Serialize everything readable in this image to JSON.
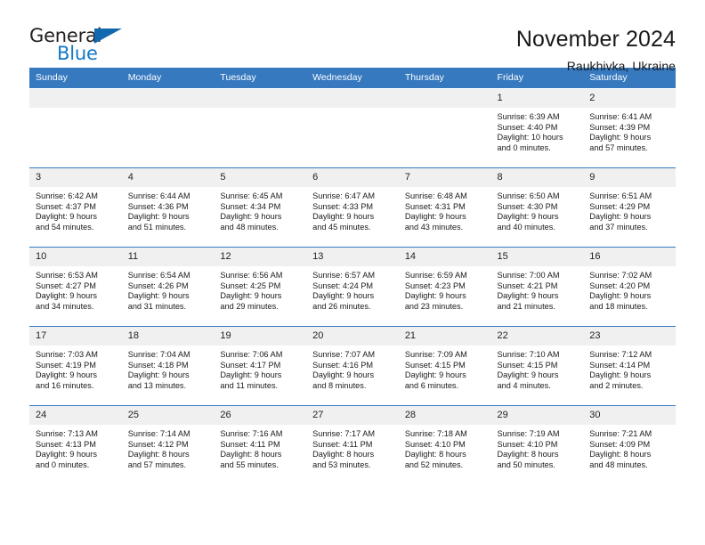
{
  "logo": {
    "word_top": "General",
    "word_bottom": "Blue",
    "triangle_color": "#1269b0",
    "blue_color": "#1478c4",
    "dark_color": "#231f20"
  },
  "header": {
    "title": "November 2024",
    "location": "Raukhivka, Ukraine"
  },
  "theme": {
    "header_bg": "#3679bf",
    "daynum_bg": "#f0f0f0",
    "text": "#1a1a1a"
  },
  "weekdays": [
    "Sunday",
    "Monday",
    "Tuesday",
    "Wednesday",
    "Thursday",
    "Friday",
    "Saturday"
  ],
  "weeks": [
    [
      {
        "day": "",
        "blank": true,
        "sunrise": "",
        "sunset": "",
        "daylight1": "",
        "daylight2": ""
      },
      {
        "day": "",
        "blank": true,
        "sunrise": "",
        "sunset": "",
        "daylight1": "",
        "daylight2": ""
      },
      {
        "day": "",
        "blank": true,
        "sunrise": "",
        "sunset": "",
        "daylight1": "",
        "daylight2": ""
      },
      {
        "day": "",
        "blank": true,
        "sunrise": "",
        "sunset": "",
        "daylight1": "",
        "daylight2": ""
      },
      {
        "day": "",
        "blank": true,
        "sunrise": "",
        "sunset": "",
        "daylight1": "",
        "daylight2": ""
      },
      {
        "day": "1",
        "blank": false,
        "sunrise": "Sunrise: 6:39 AM",
        "sunset": "Sunset: 4:40 PM",
        "daylight1": "Daylight: 10 hours",
        "daylight2": "and 0 minutes."
      },
      {
        "day": "2",
        "blank": false,
        "sunrise": "Sunrise: 6:41 AM",
        "sunset": "Sunset: 4:39 PM",
        "daylight1": "Daylight: 9 hours",
        "daylight2": "and 57 minutes."
      }
    ],
    [
      {
        "day": "3",
        "blank": false,
        "sunrise": "Sunrise: 6:42 AM",
        "sunset": "Sunset: 4:37 PM",
        "daylight1": "Daylight: 9 hours",
        "daylight2": "and 54 minutes."
      },
      {
        "day": "4",
        "blank": false,
        "sunrise": "Sunrise: 6:44 AM",
        "sunset": "Sunset: 4:36 PM",
        "daylight1": "Daylight: 9 hours",
        "daylight2": "and 51 minutes."
      },
      {
        "day": "5",
        "blank": false,
        "sunrise": "Sunrise: 6:45 AM",
        "sunset": "Sunset: 4:34 PM",
        "daylight1": "Daylight: 9 hours",
        "daylight2": "and 48 minutes."
      },
      {
        "day": "6",
        "blank": false,
        "sunrise": "Sunrise: 6:47 AM",
        "sunset": "Sunset: 4:33 PM",
        "daylight1": "Daylight: 9 hours",
        "daylight2": "and 45 minutes."
      },
      {
        "day": "7",
        "blank": false,
        "sunrise": "Sunrise: 6:48 AM",
        "sunset": "Sunset: 4:31 PM",
        "daylight1": "Daylight: 9 hours",
        "daylight2": "and 43 minutes."
      },
      {
        "day": "8",
        "blank": false,
        "sunrise": "Sunrise: 6:50 AM",
        "sunset": "Sunset: 4:30 PM",
        "daylight1": "Daylight: 9 hours",
        "daylight2": "and 40 minutes."
      },
      {
        "day": "9",
        "blank": false,
        "sunrise": "Sunrise: 6:51 AM",
        "sunset": "Sunset: 4:29 PM",
        "daylight1": "Daylight: 9 hours",
        "daylight2": "and 37 minutes."
      }
    ],
    [
      {
        "day": "10",
        "blank": false,
        "sunrise": "Sunrise: 6:53 AM",
        "sunset": "Sunset: 4:27 PM",
        "daylight1": "Daylight: 9 hours",
        "daylight2": "and 34 minutes."
      },
      {
        "day": "11",
        "blank": false,
        "sunrise": "Sunrise: 6:54 AM",
        "sunset": "Sunset: 4:26 PM",
        "daylight1": "Daylight: 9 hours",
        "daylight2": "and 31 minutes."
      },
      {
        "day": "12",
        "blank": false,
        "sunrise": "Sunrise: 6:56 AM",
        "sunset": "Sunset: 4:25 PM",
        "daylight1": "Daylight: 9 hours",
        "daylight2": "and 29 minutes."
      },
      {
        "day": "13",
        "blank": false,
        "sunrise": "Sunrise: 6:57 AM",
        "sunset": "Sunset: 4:24 PM",
        "daylight1": "Daylight: 9 hours",
        "daylight2": "and 26 minutes."
      },
      {
        "day": "14",
        "blank": false,
        "sunrise": "Sunrise: 6:59 AM",
        "sunset": "Sunset: 4:23 PM",
        "daylight1": "Daylight: 9 hours",
        "daylight2": "and 23 minutes."
      },
      {
        "day": "15",
        "blank": false,
        "sunrise": "Sunrise: 7:00 AM",
        "sunset": "Sunset: 4:21 PM",
        "daylight1": "Daylight: 9 hours",
        "daylight2": "and 21 minutes."
      },
      {
        "day": "16",
        "blank": false,
        "sunrise": "Sunrise: 7:02 AM",
        "sunset": "Sunset: 4:20 PM",
        "daylight1": "Daylight: 9 hours",
        "daylight2": "and 18 minutes."
      }
    ],
    [
      {
        "day": "17",
        "blank": false,
        "sunrise": "Sunrise: 7:03 AM",
        "sunset": "Sunset: 4:19 PM",
        "daylight1": "Daylight: 9 hours",
        "daylight2": "and 16 minutes."
      },
      {
        "day": "18",
        "blank": false,
        "sunrise": "Sunrise: 7:04 AM",
        "sunset": "Sunset: 4:18 PM",
        "daylight1": "Daylight: 9 hours",
        "daylight2": "and 13 minutes."
      },
      {
        "day": "19",
        "blank": false,
        "sunrise": "Sunrise: 7:06 AM",
        "sunset": "Sunset: 4:17 PM",
        "daylight1": "Daylight: 9 hours",
        "daylight2": "and 11 minutes."
      },
      {
        "day": "20",
        "blank": false,
        "sunrise": "Sunrise: 7:07 AM",
        "sunset": "Sunset: 4:16 PM",
        "daylight1": "Daylight: 9 hours",
        "daylight2": "and 8 minutes."
      },
      {
        "day": "21",
        "blank": false,
        "sunrise": "Sunrise: 7:09 AM",
        "sunset": "Sunset: 4:15 PM",
        "daylight1": "Daylight: 9 hours",
        "daylight2": "and 6 minutes."
      },
      {
        "day": "22",
        "blank": false,
        "sunrise": "Sunrise: 7:10 AM",
        "sunset": "Sunset: 4:15 PM",
        "daylight1": "Daylight: 9 hours",
        "daylight2": "and 4 minutes."
      },
      {
        "day": "23",
        "blank": false,
        "sunrise": "Sunrise: 7:12 AM",
        "sunset": "Sunset: 4:14 PM",
        "daylight1": "Daylight: 9 hours",
        "daylight2": "and 2 minutes."
      }
    ],
    [
      {
        "day": "24",
        "blank": false,
        "sunrise": "Sunrise: 7:13 AM",
        "sunset": "Sunset: 4:13 PM",
        "daylight1": "Daylight: 9 hours",
        "daylight2": "and 0 minutes."
      },
      {
        "day": "25",
        "blank": false,
        "sunrise": "Sunrise: 7:14 AM",
        "sunset": "Sunset: 4:12 PM",
        "daylight1": "Daylight: 8 hours",
        "daylight2": "and 57 minutes."
      },
      {
        "day": "26",
        "blank": false,
        "sunrise": "Sunrise: 7:16 AM",
        "sunset": "Sunset: 4:11 PM",
        "daylight1": "Daylight: 8 hours",
        "daylight2": "and 55 minutes."
      },
      {
        "day": "27",
        "blank": false,
        "sunrise": "Sunrise: 7:17 AM",
        "sunset": "Sunset: 4:11 PM",
        "daylight1": "Daylight: 8 hours",
        "daylight2": "and 53 minutes."
      },
      {
        "day": "28",
        "blank": false,
        "sunrise": "Sunrise: 7:18 AM",
        "sunset": "Sunset: 4:10 PM",
        "daylight1": "Daylight: 8 hours",
        "daylight2": "and 52 minutes."
      },
      {
        "day": "29",
        "blank": false,
        "sunrise": "Sunrise: 7:19 AM",
        "sunset": "Sunset: 4:10 PM",
        "daylight1": "Daylight: 8 hours",
        "daylight2": "and 50 minutes."
      },
      {
        "day": "30",
        "blank": false,
        "sunrise": "Sunrise: 7:21 AM",
        "sunset": "Sunset: 4:09 PM",
        "daylight1": "Daylight: 8 hours",
        "daylight2": "and 48 minutes."
      }
    ]
  ]
}
